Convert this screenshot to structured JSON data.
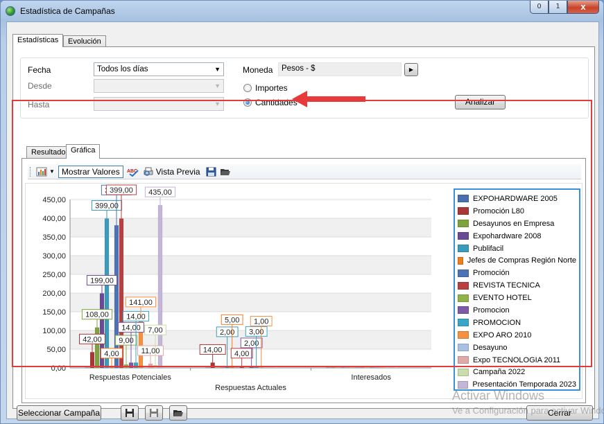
{
  "window": {
    "title": "Estadística de Campañas",
    "min": "0",
    "max": "1",
    "close": "x"
  },
  "tabs": {
    "estadisticas": "Estadísticas",
    "evolucion": "Evolución"
  },
  "filters": {
    "fecha_label": "Fecha",
    "fecha_value": "Todos los días",
    "desde_label": "Desde",
    "hasta_label": "Hasta",
    "moneda_label": "Moneda",
    "moneda_value": "Pesos - $",
    "importes_label": "Importes",
    "cantidades_label": "Cantidades",
    "analizar_label": "Analizar"
  },
  "result_tabs": {
    "resultado": "Resultado",
    "grafica": "Gráfica"
  },
  "toolbar": {
    "mostrar_valores": "Mostrar Valores",
    "vista_previa": "Vista Previa"
  },
  "chart_data": {
    "type": "bar",
    "categories": [
      "Respuestas Potenciales",
      "Respuestas Actuales",
      "Interesados"
    ],
    "ylim": [
      0,
      450
    ],
    "yticks": [
      "0,00",
      "50,00",
      "100,00",
      "150,00",
      "200,00",
      "250,00",
      "300,00",
      "350,00",
      "400,00",
      "450,00"
    ],
    "series": [
      {
        "name": "EXPOHARDWARE 2005",
        "color": "#4a6fb0",
        "values": [
          0,
          0,
          0
        ],
        "labels": [
          "",
          "",
          ""
        ]
      },
      {
        "name": "Promoción L80",
        "color": "#a83838",
        "values": [
          42,
          14,
          0
        ],
        "labels": [
          "42,00",
          "14,00",
          ""
        ]
      },
      {
        "name": "Desayunos en Empresa",
        "color": "#7ea33c",
        "values": [
          108,
          0,
          0
        ],
        "labels": [
          "108,00",
          "",
          ""
        ]
      },
      {
        "name": "Expohardware 2008",
        "color": "#6a4a94",
        "values": [
          199,
          0,
          0
        ],
        "labels": [
          "199,00",
          "",
          ""
        ]
      },
      {
        "name": "Publifacil",
        "color": "#3a9bbb",
        "values": [
          399,
          2,
          0
        ],
        "labels": [
          "399,00",
          "2,00",
          ""
        ]
      },
      {
        "name": "Jefes de Compras Región Norte",
        "color": "#ef7e20",
        "values": [
          4,
          5,
          0
        ],
        "labels": [
          "4,00",
          "5,00",
          ""
        ]
      },
      {
        "name": "Promoción",
        "color": "#4d73b6",
        "values": [
          381,
          0,
          0
        ],
        "labels": [
          "381,00",
          "",
          ""
        ]
      },
      {
        "name": "REVISTA TECNICA",
        "color": "#b74141",
        "values": [
          399,
          4,
          0
        ],
        "labels": [
          "399,00",
          "4,00",
          ""
        ]
      },
      {
        "name": "EVENTO HOTEL",
        "color": "#8fb24a",
        "values": [
          9,
          0,
          0
        ],
        "labels": [
          "9,00",
          "",
          ""
        ]
      },
      {
        "name": "Promocion",
        "color": "#7c5aa6",
        "values": [
          14,
          2,
          0
        ],
        "labels": [
          "14,00",
          "2,00",
          ""
        ]
      },
      {
        "name": "PROMOCION",
        "color": "#39a6c5",
        "values": [
          14,
          3,
          0
        ],
        "labels": [
          "14,00",
          "3,00",
          ""
        ]
      },
      {
        "name": "EXPO ARO 2010",
        "color": "#f39242",
        "values": [
          141,
          1,
          0
        ],
        "labels": [
          "141,00",
          "1,00",
          ""
        ]
      },
      {
        "name": "Desayuno",
        "color": "#a9c0e2",
        "values": [
          0,
          0,
          0
        ],
        "labels": [
          "",
          "",
          ""
        ]
      },
      {
        "name": "Expo TECNOLOGIA 2011",
        "color": "#e0aaa8",
        "values": [
          11,
          0,
          0
        ],
        "labels": [
          "11,00",
          "",
          ""
        ]
      },
      {
        "name": "Campaña 2022",
        "color": "#c9dcab",
        "values": [
          7,
          0,
          0
        ],
        "labels": [
          "7,00",
          "",
          ""
        ]
      },
      {
        "name": "Presentación Temporada 2023",
        "color": "#c4b6d8",
        "values": [
          435,
          0,
          0
        ],
        "labels": [
          "435,00",
          "",
          ""
        ]
      }
    ]
  },
  "bottom": {
    "seleccionar": "Seleccionar Campaña",
    "cerrar": "Cerrar"
  },
  "watermark": {
    "line1": "Activar Windows",
    "line2": "Ve a Configuración para activar Windows."
  }
}
